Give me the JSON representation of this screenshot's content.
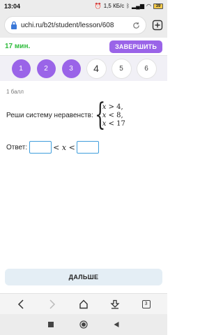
{
  "status_bar": {
    "time": "13:04",
    "net_speed": "1,5 КБ/с",
    "battery": "39"
  },
  "browser": {
    "url": "uchi.ru/b2t/student/lesson/608"
  },
  "header": {
    "timer": "17 мин.",
    "finish_label": "ЗАВЕРШИТЬ"
  },
  "steps": [
    {
      "label": "1",
      "state": "done"
    },
    {
      "label": "2",
      "state": "done"
    },
    {
      "label": "3",
      "state": "done"
    },
    {
      "label": "4",
      "state": "current"
    },
    {
      "label": "5",
      "state": "todo"
    },
    {
      "label": "6",
      "state": "todo"
    }
  ],
  "task": {
    "score": "1 балл",
    "prompt": "Реши систему неравенств:",
    "inequalities": [
      {
        "var": "x",
        "rel": ">",
        "rhs": "4,"
      },
      {
        "var": "x",
        "rel": "<",
        "rhs": "8,"
      },
      {
        "var": "x",
        "rel": "<",
        "rhs": "17"
      }
    ],
    "answer_label": "Ответ:",
    "answer_var": "x"
  },
  "next_label": "ДАЛЬШЕ",
  "nav": {
    "tabs_count": "3"
  },
  "colors": {
    "accent_purple": "#9a64e8",
    "timer_green": "#2dbb3b",
    "input_blue": "#3f9ddb"
  }
}
